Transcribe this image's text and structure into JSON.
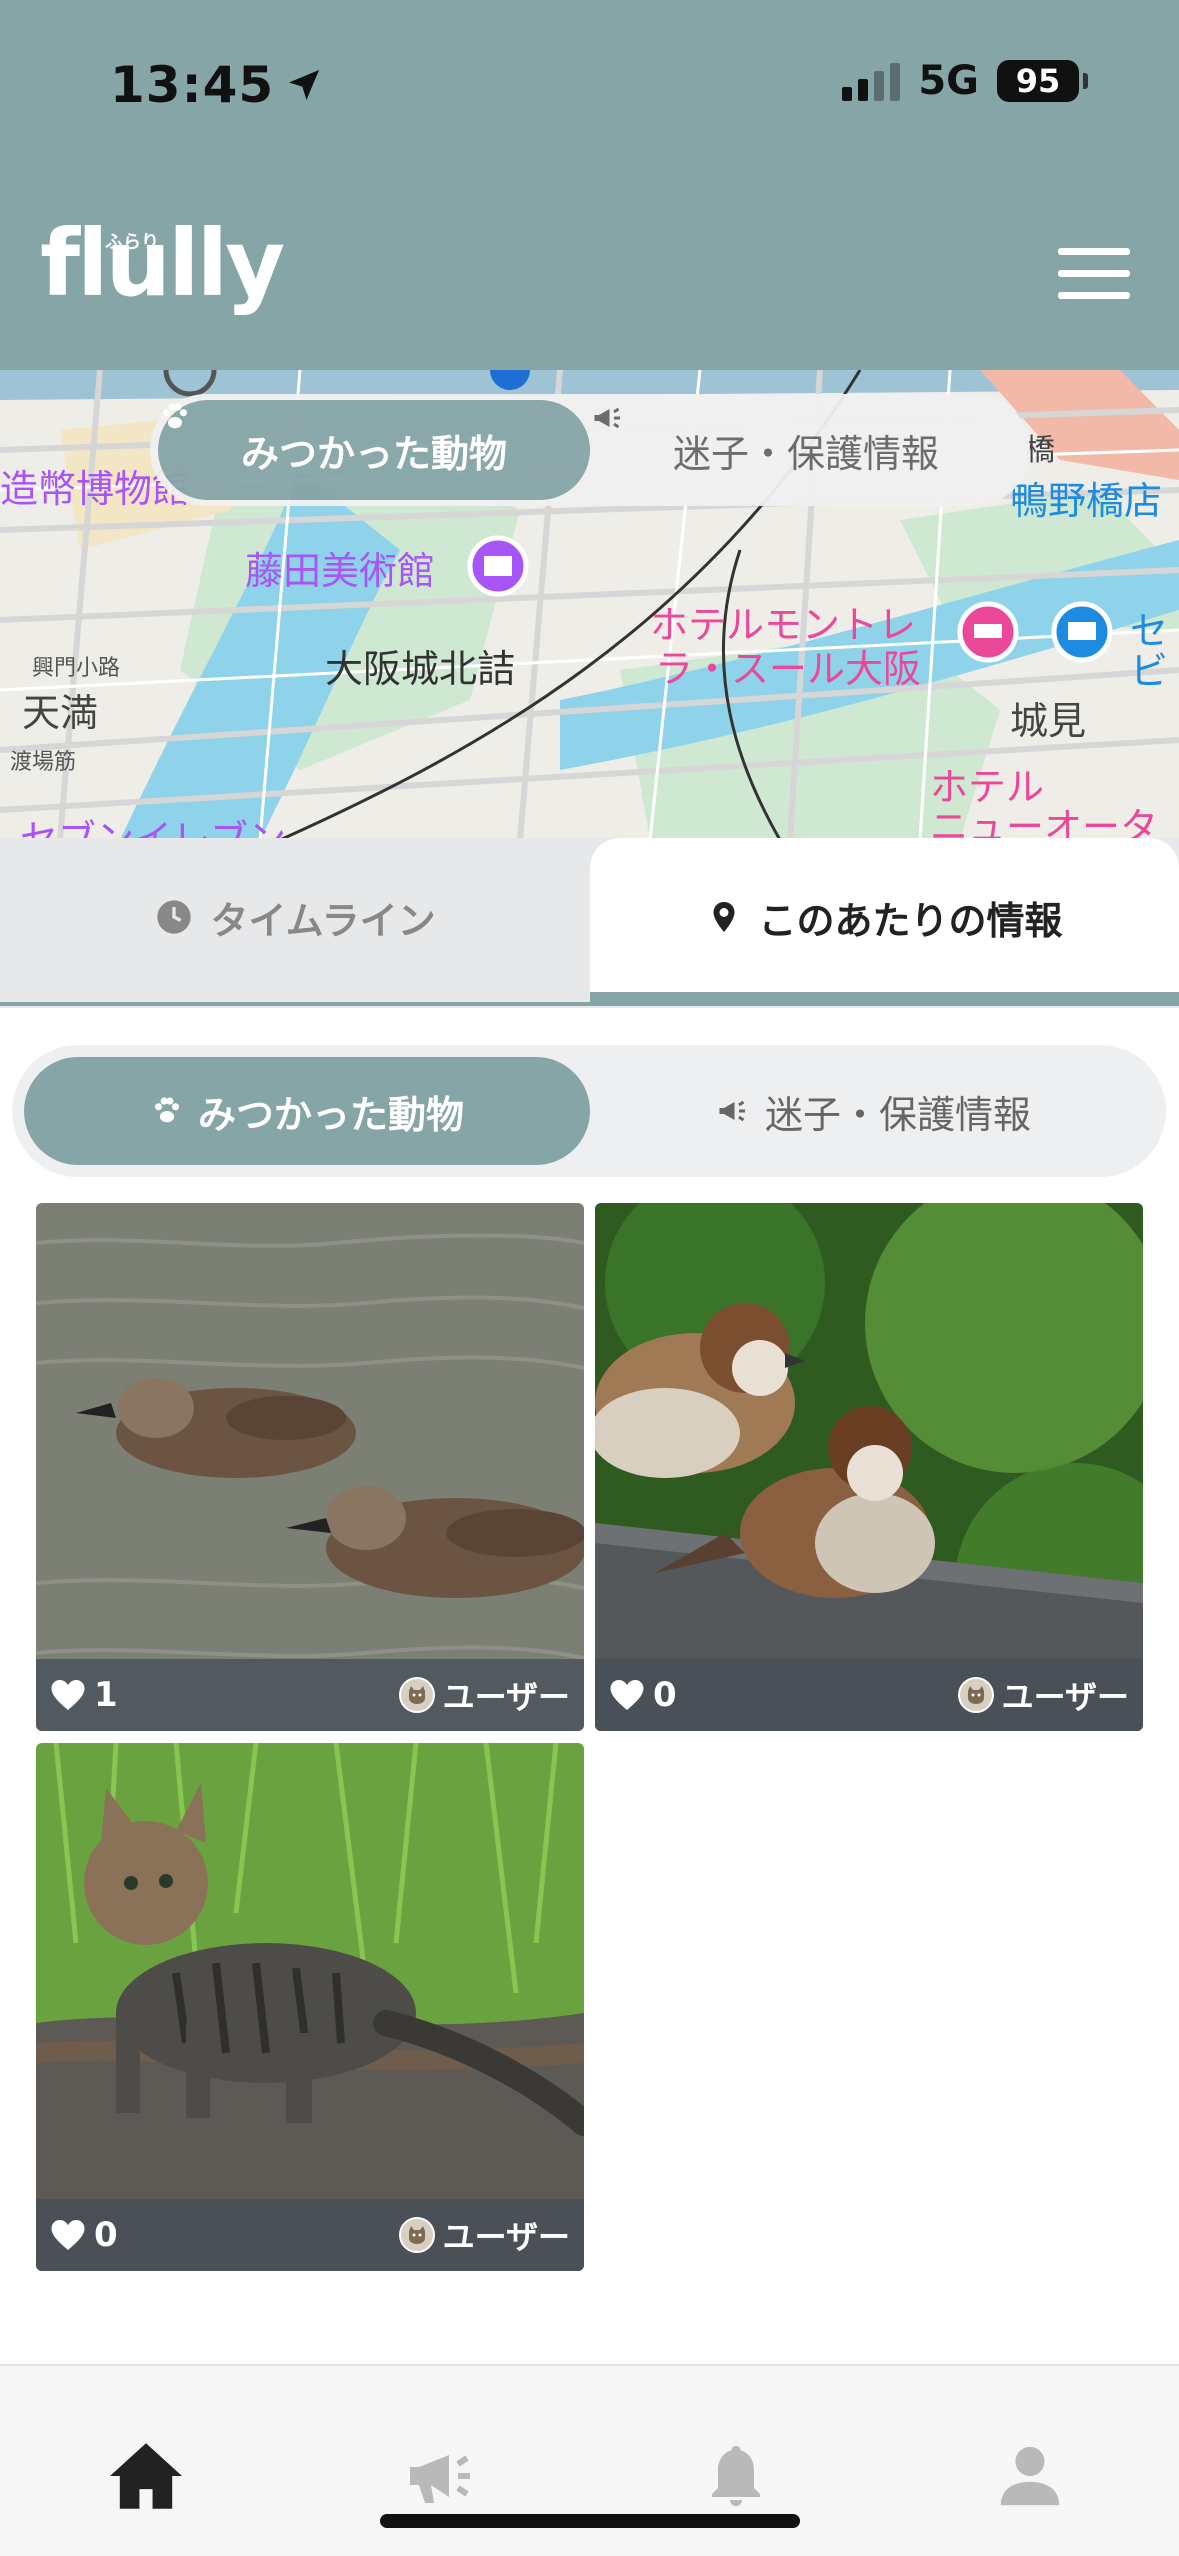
{
  "status": {
    "time": "13:45",
    "network": "5G",
    "battery": "95"
  },
  "header": {
    "logo": "flully",
    "logo_ruby": "ふらり"
  },
  "map": {
    "toggle": {
      "active": "みつかった動物",
      "inactive": "迷子・保護情報"
    },
    "labels": {
      "museum": "藤田美術館",
      "station": "大阪城北詰",
      "hotel1_line1": "ホテルモントレ",
      "hotel1_line2": "ラ・スール大阪",
      "joken": "城見",
      "hotel2_line1": "ホテル",
      "hotel2_line2": "ニューオータ",
      "tenma": "天満",
      "kouban": "興門小路",
      "watarai": "渡場筋",
      "kamotsu": "鴨野橋店",
      "zohei": "造幣博物館",
      "seven": "セブンイレブン",
      "hashi": "橋",
      "se": "セ",
      "bi": "ビ"
    }
  },
  "tabs": {
    "timeline": "タイムライン",
    "nearby": "このあたりの情報"
  },
  "subtoggle": {
    "active": "みつかった動物",
    "inactive": "迷子・保護情報"
  },
  "cards": [
    {
      "likes": "1",
      "user": "ユーザー",
      "subject": "ducks"
    },
    {
      "likes": "0",
      "user": "ユーザー",
      "subject": "sparrows"
    },
    {
      "likes": "0",
      "user": "ユーザー",
      "subject": "cat"
    }
  ],
  "colors": {
    "accent": "#86a5a7"
  }
}
